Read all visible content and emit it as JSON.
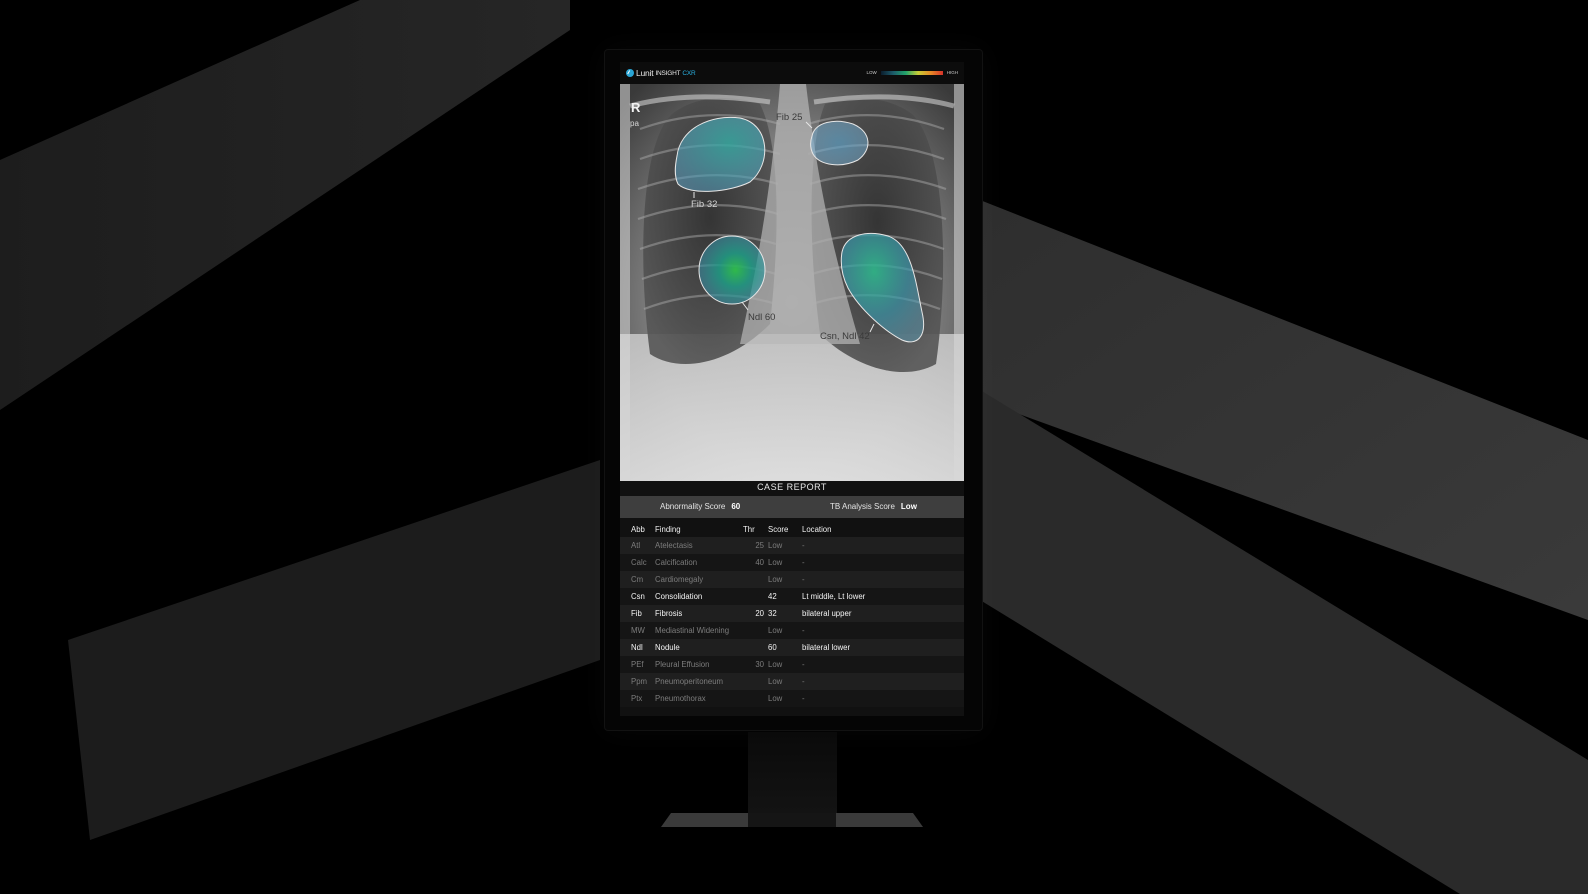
{
  "header": {
    "brand": "Lunit",
    "product": "INSIGHT",
    "product_suffix": "CXR",
    "legend_low": "LOW",
    "legend_high": "HIGH"
  },
  "image": {
    "side_marker": "R",
    "view_marker": "pa",
    "lesions": [
      {
        "label": "Fib 32"
      },
      {
        "label": "Fib 25"
      },
      {
        "label": "Ndl 60"
      },
      {
        "label": "Csn, Ndl 42"
      }
    ]
  },
  "report": {
    "title": "CASE REPORT",
    "abnormality_label": "Abnormality Score",
    "abnormality_value": "60",
    "tb_label": "TB Analysis Score",
    "tb_value": "Low",
    "columns": {
      "abb": "Abb",
      "finding": "Finding",
      "thr": "Thr",
      "score": "Score",
      "location": "Location"
    },
    "rows": [
      {
        "abb": "Atl",
        "finding": "Atelectasis",
        "thr": "25",
        "score": "Low",
        "location": "-",
        "positive": false
      },
      {
        "abb": "Calc",
        "finding": "Calcification",
        "thr": "40",
        "score": "Low",
        "location": "-",
        "positive": false
      },
      {
        "abb": "Cm",
        "finding": "Cardiomegaly",
        "thr": "",
        "score": "Low",
        "location": "-",
        "positive": false
      },
      {
        "abb": "Csn",
        "finding": "Consolidation",
        "thr": "",
        "score": "42",
        "location": "Lt middle, Lt lower",
        "positive": true
      },
      {
        "abb": "Fib",
        "finding": "Fibrosis",
        "thr": "20",
        "score": "32",
        "location": "bilateral upper",
        "positive": true
      },
      {
        "abb": "MW",
        "finding": "Mediastinal Widening",
        "thr": "",
        "score": "Low",
        "location": "-",
        "positive": false
      },
      {
        "abb": "Ndl",
        "finding": "Nodule",
        "thr": "",
        "score": "60",
        "location": "bilateral lower",
        "positive": true
      },
      {
        "abb": "PEf",
        "finding": "Pleural Effusion",
        "thr": "30",
        "score": "Low",
        "location": "-",
        "positive": false
      },
      {
        "abb": "Ppm",
        "finding": "Pneumoperitoneum",
        "thr": "",
        "score": "Low",
        "location": "-",
        "positive": false
      },
      {
        "abb": "Ptx",
        "finding": "Pneumothorax",
        "thr": "",
        "score": "Low",
        "location": "-",
        "positive": false
      }
    ]
  },
  "colors": {
    "accent": "#2aa6d6",
    "background": "#000000",
    "score_bar": "#3e3e3e"
  }
}
